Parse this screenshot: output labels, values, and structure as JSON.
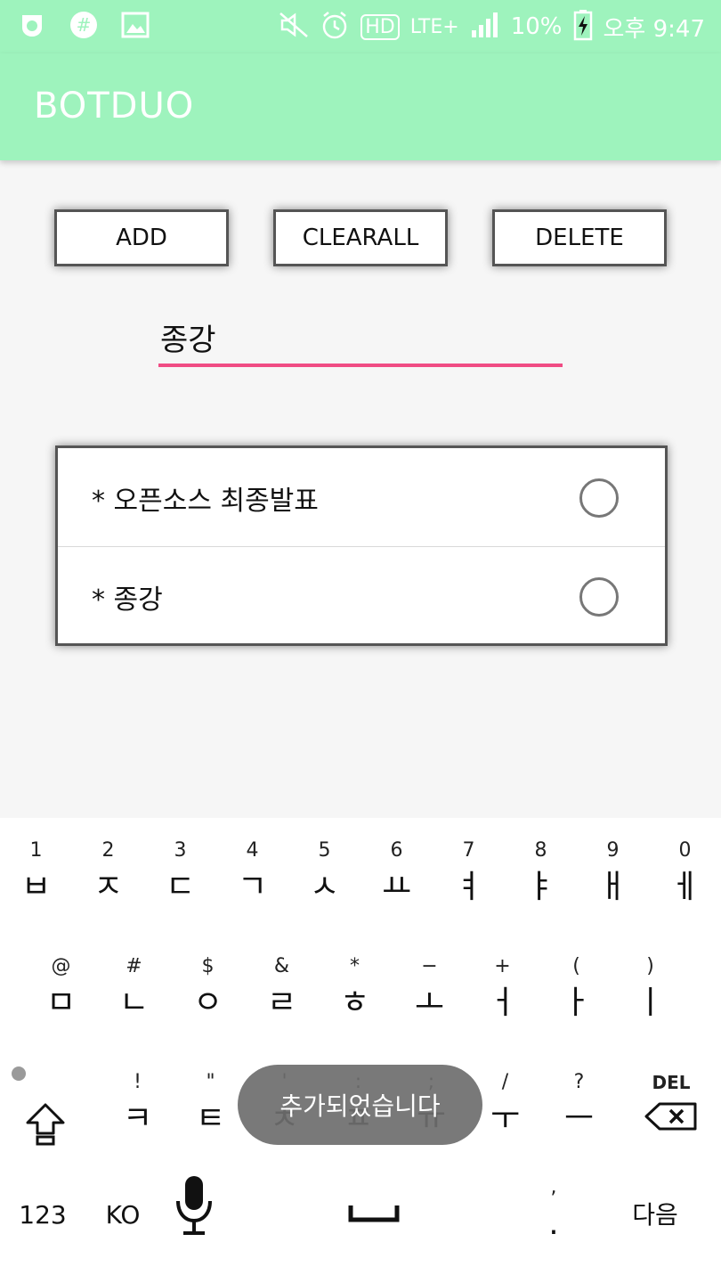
{
  "status_bar": {
    "battery": "10%",
    "time": "오후 9:47",
    "network": "LTE+",
    "hd": "HD"
  },
  "app": {
    "title": "BOTDUO"
  },
  "buttons": {
    "add": "ADD",
    "clearall": "CLEARALL",
    "delete": "DELETE"
  },
  "input": {
    "value": "종강"
  },
  "list": {
    "items": [
      {
        "label": "* 오픈소스 최종발표"
      },
      {
        "label": "* 종강"
      }
    ]
  },
  "keyboard": {
    "row1": [
      {
        "hint": "1",
        "key": "ㅂ"
      },
      {
        "hint": "2",
        "key": "ㅈ"
      },
      {
        "hint": "3",
        "key": "ㄷ"
      },
      {
        "hint": "4",
        "key": "ㄱ"
      },
      {
        "hint": "5",
        "key": "ㅅ"
      },
      {
        "hint": "6",
        "key": "ㅛ"
      },
      {
        "hint": "7",
        "key": "ㅕ"
      },
      {
        "hint": "8",
        "key": "ㅑ"
      },
      {
        "hint": "9",
        "key": "ㅐ"
      },
      {
        "hint": "0",
        "key": "ㅔ"
      }
    ],
    "row2": [
      {
        "hint": "@",
        "key": "ㅁ"
      },
      {
        "hint": "#",
        "key": "ㄴ"
      },
      {
        "hint": "$",
        "key": "ㅇ"
      },
      {
        "hint": "&",
        "key": "ㄹ"
      },
      {
        "hint": "*",
        "key": "ㅎ"
      },
      {
        "hint": "−",
        "key": "ㅗ"
      },
      {
        "hint": "+",
        "key": "ㅓ"
      },
      {
        "hint": "(",
        "key": "ㅏ"
      },
      {
        "hint": ")",
        "key": "ㅣ"
      }
    ],
    "row3": [
      {
        "hint": "!",
        "key": "ㅋ"
      },
      {
        "hint": "\"",
        "key": "ㅌ"
      },
      {
        "hint": "'",
        "key": "ㅊ"
      },
      {
        "hint": ":",
        "key": "ㅍ"
      },
      {
        "hint": ";",
        "key": "ㅠ"
      },
      {
        "hint": "/",
        "key": "ㅜ"
      },
      {
        "hint": "?",
        "key": "ㅡ"
      }
    ],
    "del_label": "DEL",
    "mode_123": "123",
    "lang": "KO",
    "comma": ",",
    "period": ".",
    "next": "다음"
  },
  "toast": {
    "message": "추가되었습니다"
  }
}
